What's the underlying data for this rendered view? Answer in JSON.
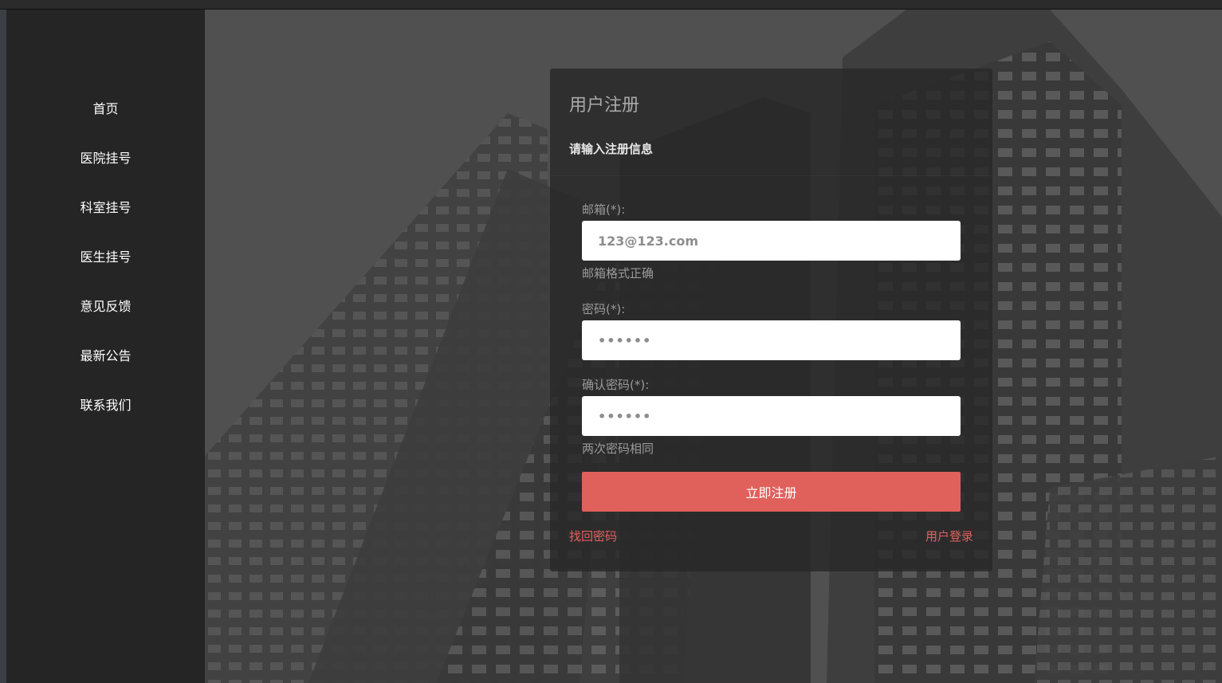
{
  "nav": {
    "items": [
      "首页",
      "医院挂号",
      "科室挂号",
      "医生挂号",
      "意见反馈",
      "最新公告",
      "联系我们"
    ]
  },
  "form": {
    "title": "用户注册",
    "subtitle": "请输入注册信息",
    "email": {
      "label": "邮箱(*):",
      "value": "123@123.com",
      "hint": "邮箱格式正确"
    },
    "password": {
      "label": "密码(*):",
      "value": "••••••"
    },
    "confirm": {
      "label": "确认密码(*):",
      "value": "••••••",
      "hint": "两次密码相同"
    },
    "submit_label": "立即注册",
    "forgot_label": "找回密码",
    "login_label": "用户登录"
  },
  "colors": {
    "accent": "#e0605b",
    "sidebar": "#252525",
    "card": "#282828"
  }
}
